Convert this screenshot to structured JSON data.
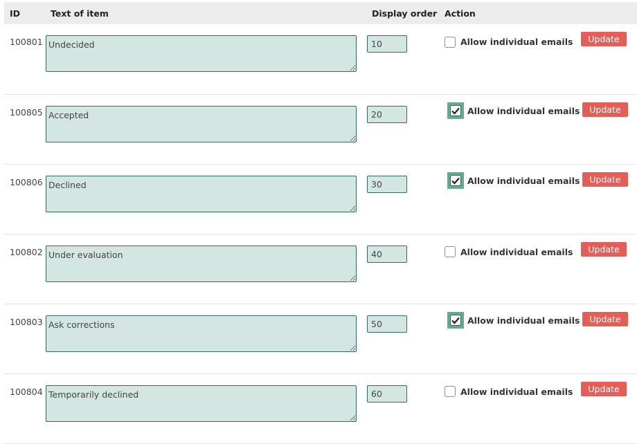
{
  "headers": {
    "id": "ID",
    "text": "Text of item",
    "order": "Display order",
    "action": "Action"
  },
  "checkbox_label": "Allow individual emails",
  "update_label": "Update",
  "colors": {
    "field_bg": "#d3e6e2",
    "field_border": "#2f6b62",
    "update_button": "#e45d57",
    "checked_highlight": "#5fae8f"
  },
  "rows": [
    {
      "id": "100801",
      "text": "Undecided",
      "order": "10",
      "allow_emails": false
    },
    {
      "id": "100805",
      "text": "Accepted",
      "order": "20",
      "allow_emails": true
    },
    {
      "id": "100806",
      "text": "Declined",
      "order": "30",
      "allow_emails": true
    },
    {
      "id": "100802",
      "text": "Under evaluation",
      "order": "40",
      "allow_emails": false
    },
    {
      "id": "100803",
      "text": "Ask corrections",
      "order": "50",
      "allow_emails": true
    },
    {
      "id": "100804",
      "text": "Temporarily declined",
      "order": "60",
      "allow_emails": false
    }
  ]
}
